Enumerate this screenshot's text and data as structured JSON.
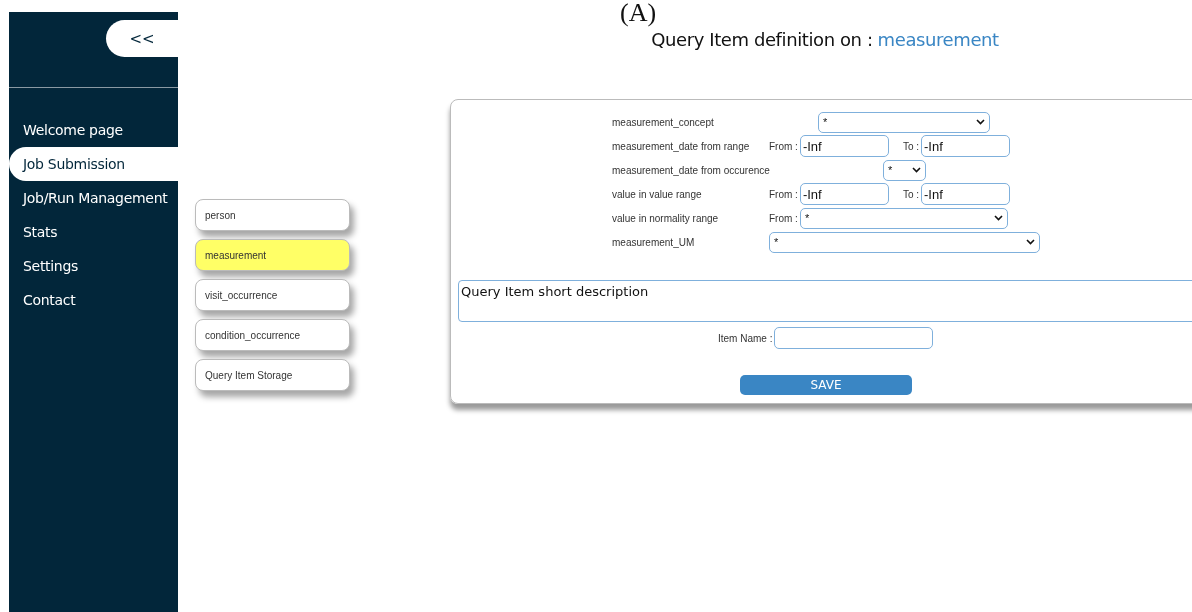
{
  "panel_label": "(A)",
  "sidebar": {
    "collapse_button": "<<",
    "items": [
      {
        "label": "Welcome page",
        "selected": false
      },
      {
        "label": "Job Submission",
        "selected": true
      },
      {
        "label": "Job/Run Management",
        "selected": false
      },
      {
        "label": "Stats",
        "selected": false
      },
      {
        "label": "Settings",
        "selected": false
      },
      {
        "label": "Contact",
        "selected": false
      }
    ]
  },
  "title": {
    "prefix": "Query Item definition on :",
    "entity": "measurement"
  },
  "tables_menu": [
    {
      "label": "person",
      "selected": false
    },
    {
      "label": "measurement",
      "selected": true
    },
    {
      "label": "visit_occurrence",
      "selected": false
    },
    {
      "label": "condition_occurrence",
      "selected": false
    },
    {
      "label": "Query Item Storage",
      "selected": false
    }
  ],
  "form": {
    "fields": [
      {
        "kind": "select",
        "label": "measurement_concept",
        "value": "*"
      },
      {
        "kind": "range",
        "label": "measurement_date from range",
        "from_label": "From :",
        "from_value": "-Inf",
        "to_label": "To :",
        "to_value": "-Inf"
      },
      {
        "kind": "short-select",
        "label": "measurement_date from occurence",
        "value": "*"
      },
      {
        "kind": "range",
        "label": "value in value range",
        "from_label": "From :",
        "from_value": "-Inf",
        "to_label": "To :",
        "to_value": "-Inf"
      },
      {
        "kind": "from-select",
        "label": "value in normality range",
        "from_label": "From :",
        "value": "*"
      },
      {
        "kind": "wide-select",
        "label": "measurement_UM",
        "value": "*"
      }
    ],
    "description": "Query Item short description",
    "item_name": {
      "label": "Item Name :"
    },
    "save_button": "SAVE"
  }
}
